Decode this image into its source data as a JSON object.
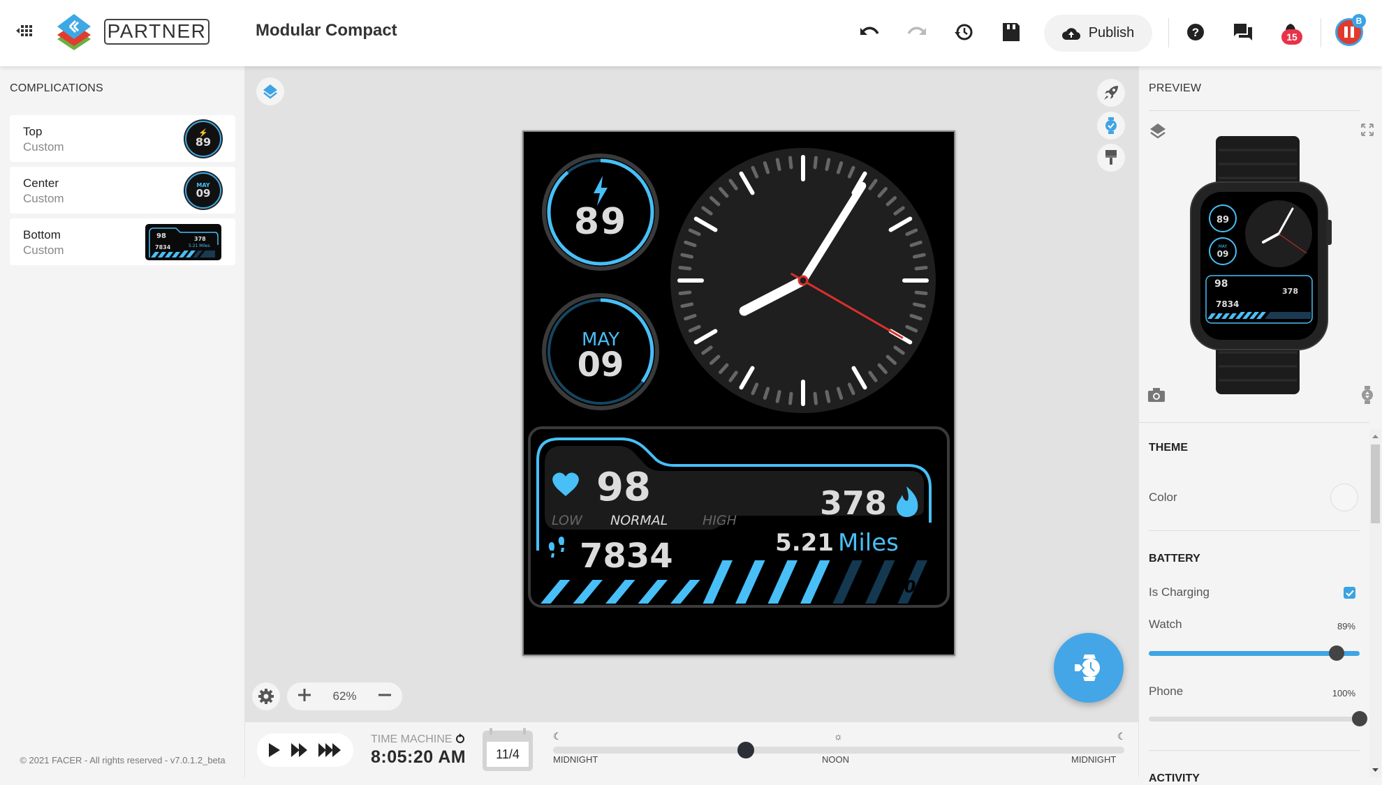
{
  "header": {
    "brand_label": "PARTNER",
    "doc_title": "Modular Compact",
    "publish_label": "Publish",
    "notification_count": "15",
    "avatar_badge": "B",
    "icons": [
      "apps-icon",
      "undo-icon",
      "redo-icon",
      "history-icon",
      "save-icon",
      "cloud-upload-icon",
      "help-icon",
      "chat-icon",
      "bell-icon"
    ]
  },
  "left_panel": {
    "title": "COMPLICATIONS",
    "items": [
      {
        "name": "Top",
        "type": "Custom",
        "thumb_value": "89"
      },
      {
        "name": "Center",
        "type": "Custom",
        "thumb_month": "MAY",
        "thumb_day": "09"
      },
      {
        "name": "Bottom",
        "type": "Custom"
      }
    ],
    "footer": "© 2021 FACER - All rights reserved - v7.0.1.2_beta"
  },
  "canvas": {
    "zoom_level": "62%",
    "watch_face": {
      "battery_value": "89",
      "battery_level": 0.89,
      "date_month": "MAY",
      "date_day": "09",
      "clock_time": {
        "hour": 8,
        "minute": 5,
        "second": 20
      },
      "heart_rate": "98",
      "heart_zones": [
        "LOW",
        "NORMAL",
        "HIGH"
      ],
      "active_zone": "NORMAL",
      "calories": "378",
      "distance_value": "5.21",
      "distance_unit": "Miles",
      "steps": "7834",
      "steps_goal": "10K",
      "steps_progress": 0.7834,
      "accent_color": "#48bff7"
    }
  },
  "timebar": {
    "label": "TIME MACHINE",
    "time": "8:05:20 AM",
    "date": "11/4",
    "day_progress": 0.337,
    "labels": [
      "MIDNIGHT",
      "NOON",
      "MIDNIGHT"
    ]
  },
  "right_panel": {
    "preview_title": "PREVIEW",
    "theme_title": "THEME",
    "color_label": "Color",
    "battery_title": "BATTERY",
    "charging_label": "Is Charging",
    "charging": true,
    "watch_label": "Watch",
    "watch_pct": "89%",
    "watch_value": 0.89,
    "phone_label": "Phone",
    "phone_pct": "100%",
    "phone_value": 1.0,
    "activity_title": "ACTIVITY",
    "accent_color": "#3fa4e4"
  }
}
